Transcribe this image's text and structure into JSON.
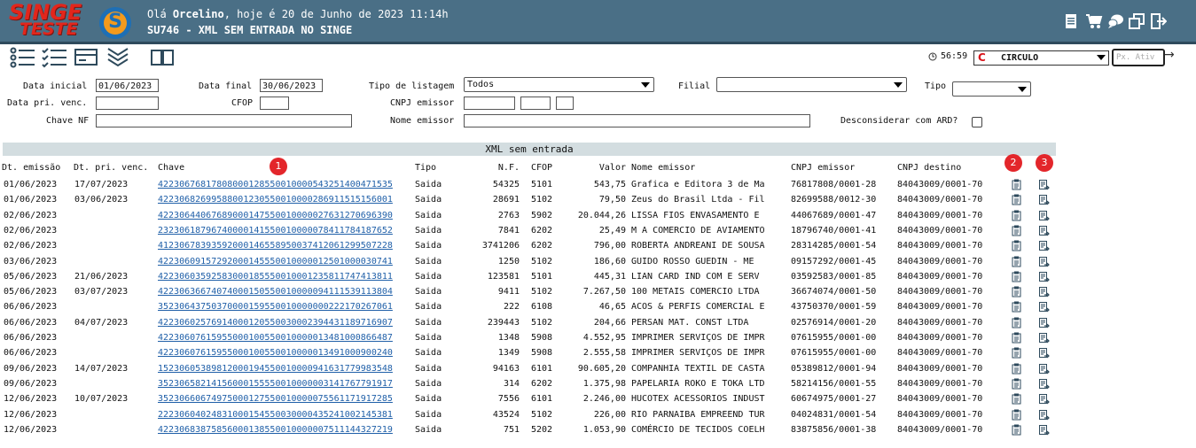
{
  "header": {
    "logo_line1": "SINGE",
    "logo_line2": "TESTE",
    "greeting_prefix": "Olá ",
    "user": "Orcelino",
    "greeting_suffix": ", hoje é 20 de Junho de 2023 11:14h",
    "title": "SU746 - XML SEM ENTRADA NO SINGE",
    "icons": [
      "document-icon",
      "cart-icon",
      "chat-icon",
      "windows-icon",
      "exit-icon"
    ],
    "bg_color": "#4a6f86",
    "logo_color": "#e2261c"
  },
  "toolbar": {
    "icons": [
      "list-icon",
      "checklist-icon",
      "card-icon",
      "chevrons-down-icon",
      "book-icon"
    ],
    "timer": "56:59",
    "company": "CIRCULO",
    "company_letter": "C",
    "px_ativ_placeholder": "Px. Ativ"
  },
  "filters": {
    "data_inicial_label": "Data inicial",
    "data_inicial": "01/06/2023",
    "data_final_label": "Data final",
    "data_final": "30/06/2023",
    "tipo_listagem_label": "Tipo de listagem",
    "tipo_listagem": "Todos",
    "filial_label": "Filial",
    "filial": "",
    "tipo_label": "Tipo",
    "tipo": "",
    "data_pri_venc_label": "Data pri. venc.",
    "cfop_label": "CFOP",
    "cnpj_emissor_label": "CNPJ emissor",
    "chave_nf_label": "Chave NF",
    "nome_emissor_label": "Nome emissor",
    "desconsiderar_label": "Desconsiderar com ARD?"
  },
  "table": {
    "title": "XML sem entrada",
    "headers": {
      "dt_emissao": "Dt. emissão",
      "dt_pri_venc": "Dt. pri. venc.",
      "chave": "Chave",
      "tipo": "Tipo",
      "nf": "N.F.",
      "cfop": "CFOP",
      "valor": "Valor",
      "nome_emissor": "Nome emissor",
      "cnpj_emissor": "CNPJ emissor",
      "cnpj_destino": "CNPJ destino"
    },
    "badges": [
      "1",
      "2",
      "3"
    ],
    "rows": [
      [
        "01/06/2023",
        "17/07/2023",
        "42230676817808000128550010000543251400471535",
        "Saida",
        "54325",
        "5101",
        "543,75",
        "Grafica e Editora 3 de Ma",
        "76817808/0001-28",
        "84043009/0001-70"
      ],
      [
        "01/06/2023",
        "03/06/2023",
        "42230682699588001230550010000286911515156001",
        "Saida",
        "28691",
        "5102",
        "79,50",
        "Zeus do Brasil Ltda - Fil",
        "82699588/0012-30",
        "84043009/0001-70"
      ],
      [
        "02/06/2023",
        "",
        "42230644067689000147550010000027631270696390",
        "Saida",
        "2763",
        "5902",
        "20.044,26",
        "LISSA FIOS ENVASAMENTO E",
        "44067689/0001-47",
        "84043009/0001-70"
      ],
      [
        "02/06/2023",
        "",
        "23230618796740000141550010000078411784187652",
        "Saida",
        "7841",
        "6202",
        "25,49",
        "M A COMERCIO DE AVIAMENTO",
        "18796740/0001-41",
        "84043009/0001-70"
      ],
      [
        "02/06/2023",
        "",
        "41230678393592000146558950037412061299507228",
        "Saida",
        "3741206",
        "6202",
        "796,00",
        "ROBERTA ANDREANI DE SOUSA",
        "28314285/0001-54",
        "84043009/0001-70"
      ],
      [
        "03/06/2023",
        "",
        "42230609157292000145550010000012501000030741",
        "Saida",
        "1250",
        "5102",
        "186,60",
        "GUIDO ROSSO GUEDIN - ME",
        "09157292/0001-45",
        "84043009/0001-70"
      ],
      [
        "05/06/2023",
        "21/06/2023",
        "42230603592583000185550010001235811747413811",
        "Saida",
        "123581",
        "5101",
        "445,31",
        "LIAN CARD IND COM E SERV",
        "03592583/0001-85",
        "84043009/0001-70"
      ],
      [
        "05/06/2023",
        "03/07/2023",
        "42230636674074000150550010000094111539113804",
        "Saida",
        "9411",
        "5102",
        "7.267,50",
        "100 METAIS COMERCIO LTDA",
        "36674074/0001-50",
        "84043009/0001-70"
      ],
      [
        "06/06/2023",
        "",
        "35230643750370000159550010000000222170267061",
        "Saida",
        "222",
        "6108",
        "46,65",
        "ACOS & PERFIS COMERCIAL E",
        "43750370/0001-59",
        "84043009/0001-70"
      ],
      [
        "06/06/2023",
        "04/07/2023",
        "42230602576914000120550030002394431189716907",
        "Saida",
        "239443",
        "5102",
        "204,66",
        "PERSAN MAT. CONST LTDA",
        "02576914/0001-20",
        "84043009/0001-70"
      ],
      [
        "06/06/2023",
        "",
        "42230607615955000100550010000013481000866487",
        "Saida",
        "1348",
        "5908",
        "4.552,95",
        "IMPRIMER SERVIÇOS DE IMPR",
        "07615955/0001-00",
        "84043009/0001-70"
      ],
      [
        "06/06/2023",
        "",
        "42230607615955000100550010000013491000900240",
        "Saida",
        "1349",
        "5908",
        "2.555,58",
        "IMPRIMER SERVIÇOS DE IMPR",
        "07615955/0001-00",
        "84043009/0001-70"
      ],
      [
        "09/06/2023",
        "14/07/2023",
        "15230605389812000194550010000941631779983548",
        "Saida",
        "94163",
        "6101",
        "90.605,20",
        "COMPANHIA TEXTIL DE CASTA",
        "05389812/0001-94",
        "84043009/0001-70"
      ],
      [
        "09/06/2023",
        "",
        "35230658214156000155550010000003141767791917",
        "Saida",
        "314",
        "6202",
        "1.375,98",
        "PAPELARIA ROKO E TOKA LTD",
        "58214156/0001-55",
        "84043009/0001-70"
      ],
      [
        "12/06/2023",
        "10/07/2023",
        "35230660674975000127550010000075561171917285",
        "Saida",
        "7556",
        "6101",
        "2.246,00",
        "HUCOTEX ACESSORIOS INDUST",
        "60674975/0001-27",
        "84043009/0001-70"
      ],
      [
        "12/06/2023",
        "",
        "22230604024831000154550030000435241002145381",
        "Saida",
        "43524",
        "5102",
        "226,00",
        "RIO PARNAIBA EMPREEND TUR",
        "04024831/0001-54",
        "84043009/0001-70"
      ],
      [
        "12/06/2023",
        "",
        "42230683875856000138550010000007511144327219",
        "Saida",
        "751",
        "5202",
        "1.053,90",
        "COMÉRCIO DE TECIDOS COELH",
        "83875856/0001-38",
        "84043009/0001-70"
      ]
    ]
  }
}
